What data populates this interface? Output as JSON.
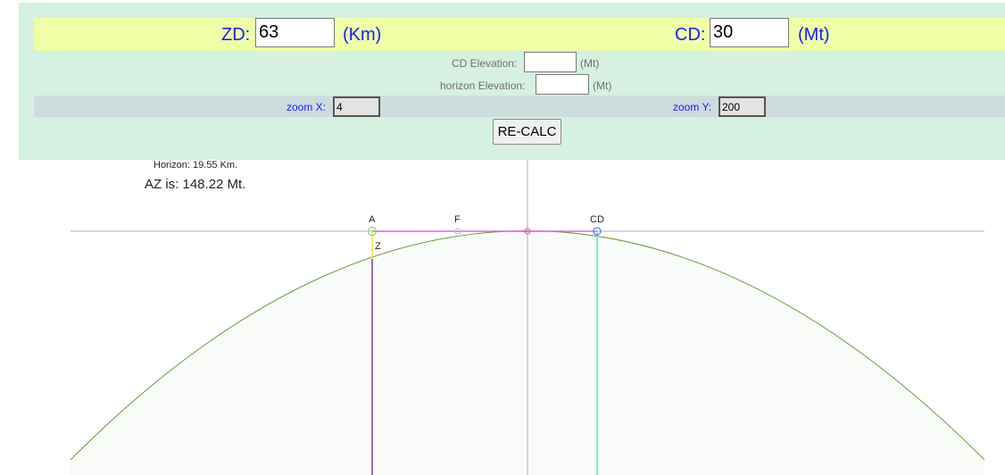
{
  "controls": {
    "zd": {
      "label": "ZD:",
      "value": "63",
      "unit": "(Km)"
    },
    "cd": {
      "label": "CD:",
      "value": "30",
      "unit": "(Mt)"
    },
    "cd_elevation": {
      "label": "CD Elevation:",
      "value": "",
      "unit": "(Mt)"
    },
    "horizon_elevation": {
      "label": "horizon Elevation:",
      "value": "",
      "unit": "(Mt)"
    },
    "zoom_x": {
      "label": "zoom X:",
      "value": "4"
    },
    "zoom_y": {
      "label": "zoom Y:",
      "value": "200"
    },
    "recalc_label": "RE-CALC"
  },
  "info": {
    "horizon": "Horizon: 19.55 Km.",
    "az": "AZ is: 148.22 Mt."
  },
  "diagram": {
    "labels": {
      "a": "A",
      "f": "F",
      "cd": "CD",
      "z": "Z"
    },
    "colors": {
      "curve": "#6a9a3a",
      "surface_fill": "#f8fbf8",
      "axis": "#b0b0b0",
      "tangent": "#e060e0",
      "drop": "#f0e040",
      "a_line": "#7a3aa0",
      "cd_line": "#60e0c0",
      "a_point": "#80d080",
      "f_point": "#a0d8a0",
      "cd_point": "#4a7aff",
      "peak_point": "#e060b0"
    }
  }
}
